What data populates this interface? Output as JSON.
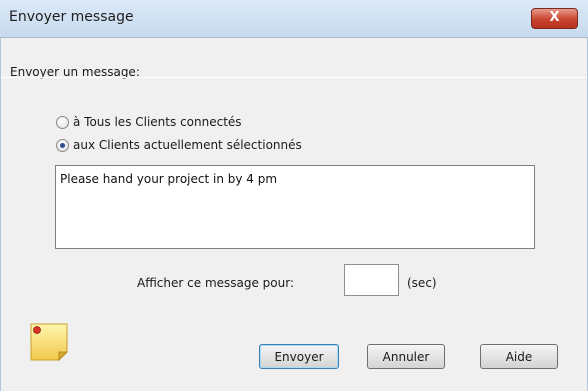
{
  "window": {
    "title": "Envoyer message",
    "close_label": "X"
  },
  "prompt": "Envoyer un message:",
  "options": {
    "all_clients_label": "à Tous les Clients connectés",
    "selected_clients_label": "aux Clients actuellement sélectionnés",
    "selected": "selected_clients"
  },
  "message": {
    "value": "Please hand your project in by 4 pm"
  },
  "duration": {
    "label": "Afficher ce message pour:",
    "value": "",
    "unit": "(sec)"
  },
  "buttons": {
    "send": "Envoyer",
    "cancel": "Annuler",
    "help": "Aide"
  },
  "icons": {
    "note": "sticky-note-icon",
    "close": "close-icon"
  },
  "colors": {
    "titlebar": "#c7daee",
    "close_button": "#c8452f",
    "dialog_background": "#f0f0f0"
  }
}
